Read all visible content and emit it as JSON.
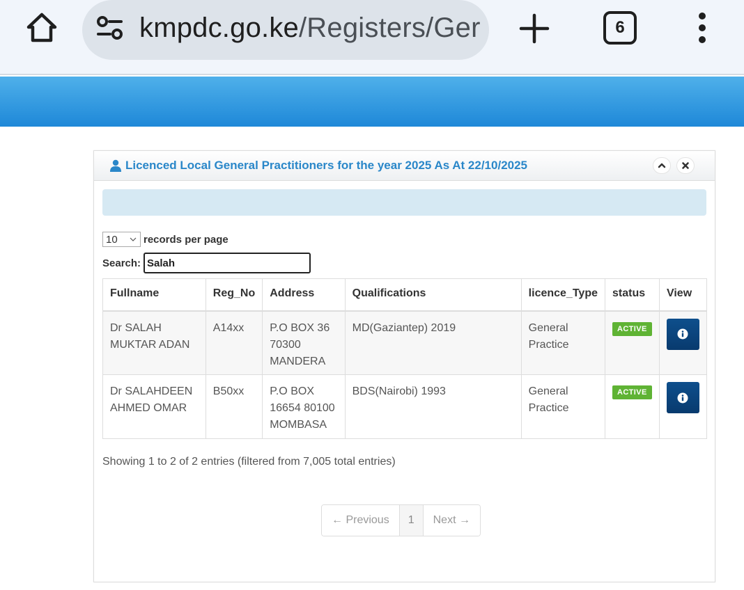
{
  "browser": {
    "url_host": "kmpdc.go.ke",
    "url_path": "/Registers/Ger",
    "tab_count": "6"
  },
  "widget": {
    "title": "Licenced Local General Practitioners for the year 2025 As At 22/10/2025"
  },
  "controls": {
    "page_length": "10",
    "page_length_label": "records per page",
    "search_label": "Search:",
    "search_value": "Salah"
  },
  "table": {
    "headers": [
      "Fullname",
      "Reg_No",
      "Address",
      "Qualifications",
      "licence_Type",
      "status",
      "View"
    ],
    "rows": [
      {
        "fullname": "Dr SALAH MUKTAR ADAN",
        "reg_no": "A14xx",
        "address": "P.O BOX 36 70300 MANDERA",
        "qualifications": "MD(Gaziantep) 2019",
        "licence_type": "General Practice",
        "status": "ACTIVE"
      },
      {
        "fullname": "Dr SALAHDEEN AHMED OMAR",
        "reg_no": "B50xx",
        "address": "P.O BOX 16654 80100 MOMBASA",
        "qualifications": "BDS(Nairobi) 1993",
        "licence_type": "General Practice",
        "status": "ACTIVE"
      }
    ]
  },
  "summary": "Showing 1 to 2 of 2 entries (filtered from 7,005 total entries)",
  "pagination": {
    "previous": "← Previous",
    "current": "1",
    "next": "Next →"
  },
  "colors": {
    "band": "#1e88d8",
    "title": "#2a87c9",
    "status_active": "#5fb334",
    "view_button": "#0a4580"
  }
}
